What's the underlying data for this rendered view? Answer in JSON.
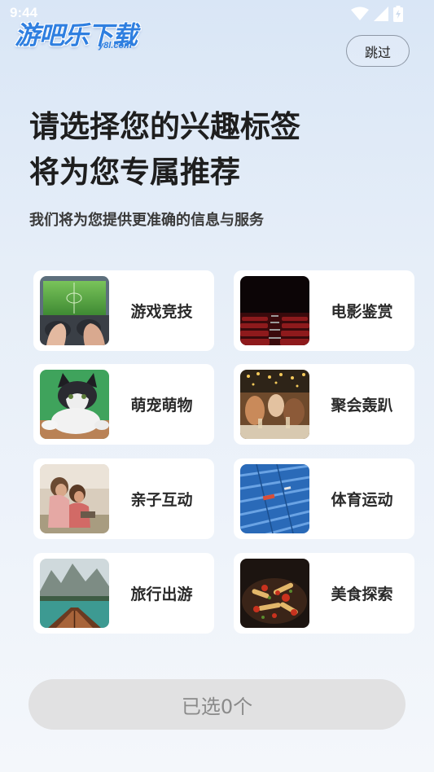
{
  "status_bar": {
    "time": "9:44"
  },
  "logo": {
    "main_text": "游吧乐下载",
    "sub_text": "y8l.com"
  },
  "header": {
    "skip_label": "跳过"
  },
  "headline": {
    "line1": "请选择您的兴趣标签",
    "line2": "将为您专属推荐"
  },
  "subhead": "我们将为您提供更准确的信息与服务",
  "tags": [
    {
      "label": "游戏竞技",
      "image": "gaming-image"
    },
    {
      "label": "电影鉴赏",
      "image": "cinema-image"
    },
    {
      "label": "萌宠萌物",
      "image": "cat-image"
    },
    {
      "label": "聚会轰趴",
      "image": "party-image"
    },
    {
      "label": "亲子互动",
      "image": "children-image"
    },
    {
      "label": "体育运动",
      "image": "stadium-image"
    },
    {
      "label": "旅行出游",
      "image": "lake-boat-image"
    },
    {
      "label": "美食探索",
      "image": "food-image"
    }
  ],
  "confirm_button": {
    "label": "已选0个"
  },
  "colors": {
    "brand": "#2f7fe0",
    "button_disabled": "#e1e1e2",
    "button_text": "#8a8a8a"
  }
}
